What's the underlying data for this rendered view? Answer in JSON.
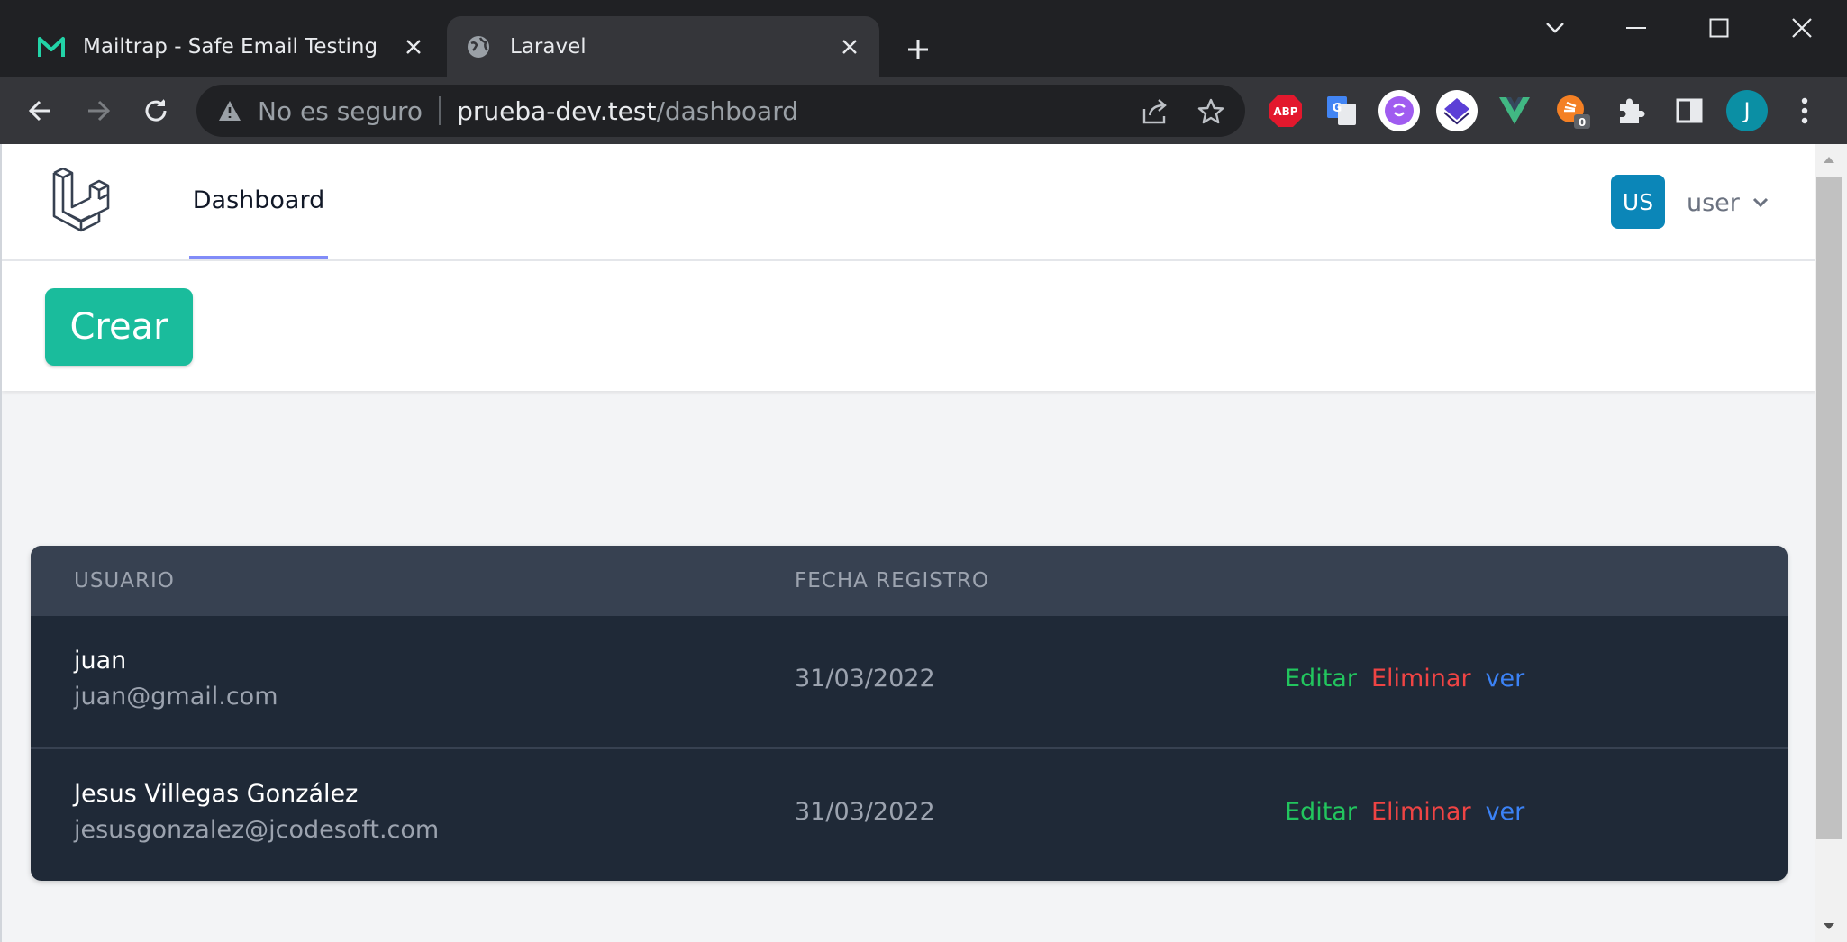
{
  "browser": {
    "tabs": [
      {
        "title": "Mailtrap - Safe Email Testing",
        "icon": "mailtrap-icon",
        "active": false
      },
      {
        "title": "Laravel",
        "icon": "globe-icon",
        "active": true
      }
    ],
    "address": {
      "security_label": "No es seguro",
      "host": "prueba-dev.test",
      "path": "/dashboard"
    },
    "extensions": [
      {
        "name": "adblock-plus-icon",
        "label": "ABP",
        "color": "#e3182d"
      },
      {
        "name": "google-translate-icon",
        "color": "#4285f4"
      },
      {
        "name": "extension-purple-icon",
        "color": "#a05cf0"
      },
      {
        "name": "extension-layers-icon",
        "color": "#5b3fd6"
      },
      {
        "name": "vue-devtools-icon",
        "color": "#41b883"
      },
      {
        "name": "stack-overflow-icon",
        "badge": "0",
        "color": "#f48024"
      }
    ],
    "profile_initial": "J"
  },
  "app": {
    "nav": {
      "dashboard_label": "Dashboard",
      "avatar_initials": "US",
      "user_name": "user"
    },
    "create_button": "Crear",
    "table": {
      "headers": {
        "user": "USUARIO",
        "date": "FECHA REGISTRO"
      },
      "rows": [
        {
          "name": "juan",
          "email": "juan@gmail.com",
          "date": "31/03/2022",
          "edit": "Editar",
          "delete": "Eliminar",
          "view": "ver"
        },
        {
          "name": "Jesus Villegas González",
          "email": "jesusgonzalez@jcodesoft.com",
          "date": "31/03/2022",
          "edit": "Editar",
          "delete": "Eliminar",
          "view": "ver"
        }
      ]
    }
  },
  "colors": {
    "primary_button": "#1abc9c",
    "avatar": "#0b86b8",
    "nav_active_underline": "#818cf8",
    "action_edit": "#22c55e",
    "action_delete": "#ef4444",
    "action_view": "#3b82f6"
  }
}
